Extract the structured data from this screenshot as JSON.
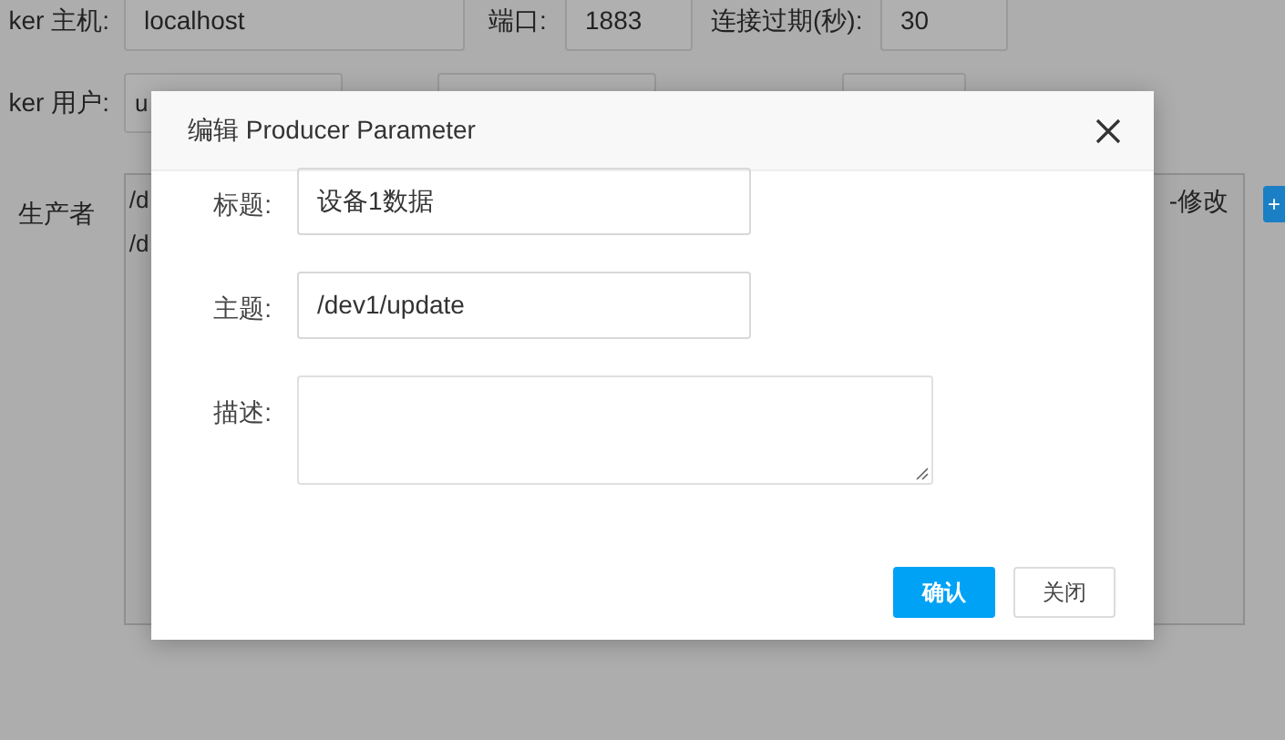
{
  "form": {
    "host_label": "ker 主机:",
    "host": "localhost",
    "port_label": "端口:",
    "port": "1883",
    "timeout_label": "连接过期(秒):",
    "timeout": "30",
    "user_label": "ker 用户:",
    "user": "u",
    "producer_label": "生产者",
    "producer_lines": [
      "/d",
      "/d"
    ],
    "producer_right_text": "-修改",
    "add_button": "+"
  },
  "dialog": {
    "title": "编辑 Producer Parameter",
    "fields": [
      {
        "label": "标题:",
        "value": "设备1数据",
        "kind": "input"
      },
      {
        "label": "主题:",
        "value": "/dev1/update",
        "kind": "input"
      },
      {
        "label": "描述:",
        "kind": "textarea"
      }
    ],
    "buttons": [
      {
        "label": "确认",
        "kind": "primary"
      },
      {
        "label": "关闭",
        "kind": "default"
      }
    ]
  }
}
